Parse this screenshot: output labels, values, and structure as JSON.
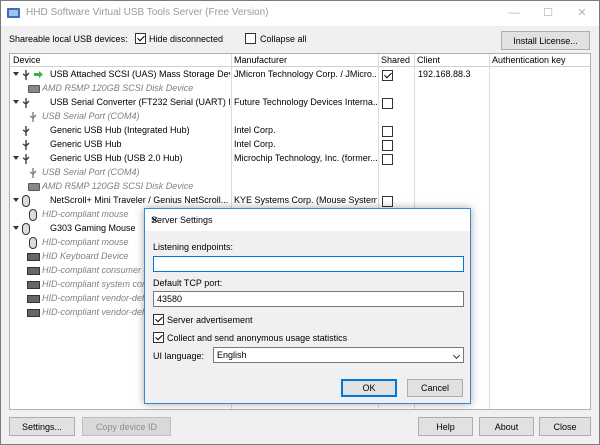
{
  "window": {
    "title": "HHD Software Virtual USB Tools Server (Free Version)",
    "minimize": "—",
    "maximize": "☐",
    "close": "✕"
  },
  "toolbar": {
    "shareable_label": "Shareable local USB devices:",
    "hide_disconnected": "Hide disconnected",
    "hide_disconnected_checked": true,
    "collapse_all": "Collapse all",
    "collapse_all_checked": false,
    "install_license": "Install License..."
  },
  "columns": {
    "device": "Device",
    "manufacturer": "Manufacturer",
    "shared": "Shared",
    "client": "Client",
    "auth_key": "Authentication key"
  },
  "rows": [
    {
      "device": "USB Attached SCSI (UAS) Mass Storage Devi...",
      "manufacturer": "JMicron Technology Corp. / JMicro...",
      "shared": true,
      "client": "192.168.88.3"
    },
    {
      "device": "AMD R5MP 120GB SCSI Disk Device"
    },
    {
      "device": "USB Serial Converter (FT232 Serial (UART) IC)",
      "manufacturer": "Future Technology Devices Interna...",
      "shared": false,
      "client": ""
    },
    {
      "device": "USB Serial Port (COM4)"
    },
    {
      "device": "Generic USB Hub (Integrated Hub)",
      "manufacturer": "Intel Corp.",
      "shared": false,
      "client": ""
    },
    {
      "device": "Generic USB Hub",
      "manufacturer": "Intel Corp.",
      "shared": false,
      "client": ""
    },
    {
      "device": "Generic USB Hub (USB 2.0 Hub)",
      "manufacturer": "Microchip Technology, Inc. (former...",
      "shared": false,
      "client": ""
    },
    {
      "device": "USB Serial Port (COM4)"
    },
    {
      "device": "AMD R5MP 120GB SCSI Disk Device"
    },
    {
      "device": "NetScroll+ Mini Traveler / Genius NetScroll...",
      "manufacturer": "KYE Systems Corp. (Mouse Systems)",
      "shared": false,
      "client": ""
    },
    {
      "device": "HID-compliant mouse"
    },
    {
      "device": "G303 Gaming Mouse"
    },
    {
      "device": "HID-compliant mouse"
    },
    {
      "device": "HID Keyboard Device"
    },
    {
      "device": "HID-compliant consumer c"
    },
    {
      "device": "HID-compliant system cont"
    },
    {
      "device": "HID-compliant vendor-defi"
    },
    {
      "device": "HID-compliant vendor-defi"
    }
  ],
  "bottom": {
    "settings": "Settings...",
    "copy_device_id": "Copy device ID",
    "help": "Help",
    "about": "About",
    "close": "Close"
  },
  "dialog": {
    "title": "Server Settings",
    "close": "✕",
    "listening_endpoints_label": "Listening endpoints:",
    "listening_endpoints_value": "",
    "default_port_label": "Default TCP port:",
    "default_port_value": "43580",
    "server_advertisement": "Server advertisement",
    "server_advertisement_checked": true,
    "collect_stats": "Collect and send anonymous usage statistics",
    "collect_stats_checked": true,
    "ui_language_label": "UI language:",
    "ui_language_value": "English",
    "ok": "OK",
    "cancel": "Cancel"
  },
  "colors": {
    "accent": "#0078d7",
    "grey_text": "#808080"
  }
}
